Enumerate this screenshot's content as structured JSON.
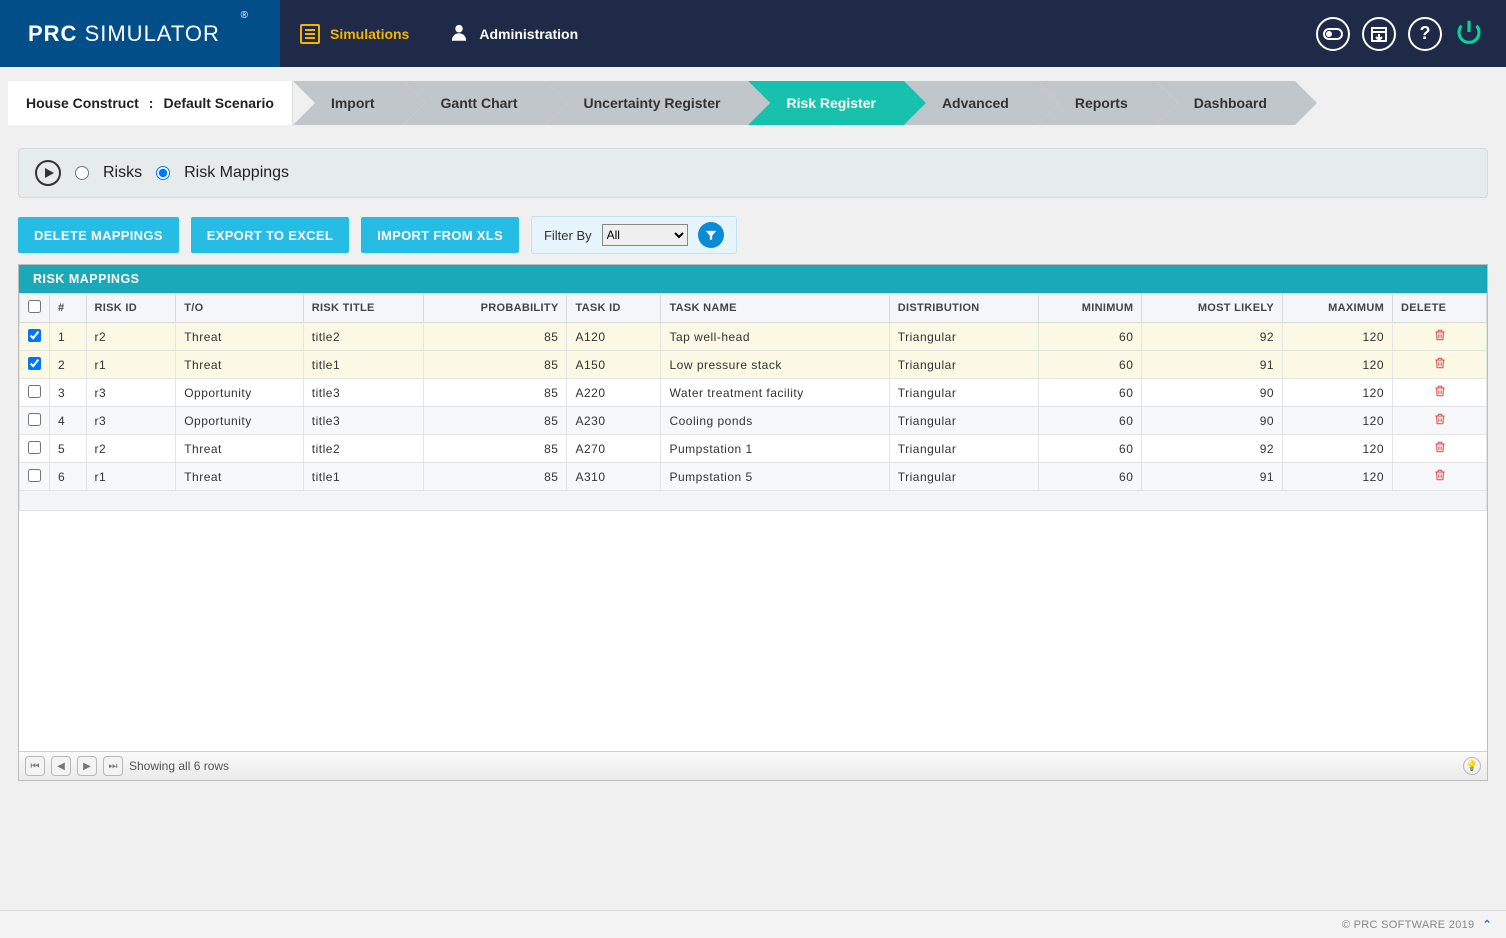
{
  "brand": {
    "bold": "PRC",
    "rest": " SIMULATOR",
    "reg": "®"
  },
  "nav": {
    "sim": "Simulations",
    "admin": "Administration"
  },
  "breadcrumb": {
    "project": "House Construct",
    "sep": ":",
    "scenario": "Default Scenario"
  },
  "tabs": [
    "Import",
    "Gantt Chart",
    "Uncertainty Register",
    "Risk Register",
    "Advanced",
    "Reports",
    "Dashboard"
  ],
  "active_tab": "Risk Register",
  "radio": {
    "risks": "Risks",
    "mappings": "Risk Mappings"
  },
  "buttons": {
    "del": "DELETE MAPPINGS",
    "excel": "EXPORT TO EXCEL",
    "import": "IMPORT FROM XLS"
  },
  "filter": {
    "label": "Filter By",
    "value": "All",
    "options": [
      "All"
    ]
  },
  "panel_title": "RISK MAPPINGS",
  "columns": [
    "#",
    "RISK ID",
    "T/O",
    "RISK TITLE",
    "PROBABILITY",
    "TASK ID",
    "TASK NAME",
    "DISTRIBUTION",
    "MINIMUM",
    "MOST LIKELY",
    "MAXIMUM",
    "DELETE"
  ],
  "rows": [
    {
      "sel": true,
      "n": "1",
      "rid": "r2",
      "to": "Threat",
      "title": "title2",
      "prob": "85",
      "tid": "A120",
      "tname": "Tap well-head",
      "dist": "Triangular",
      "min": "60",
      "ml": "92",
      "max": "120"
    },
    {
      "sel": true,
      "n": "2",
      "rid": "r1",
      "to": "Threat",
      "title": "title1",
      "prob": "85",
      "tid": "A150",
      "tname": "Low pressure stack",
      "dist": "Triangular",
      "min": "60",
      "ml": "91",
      "max": "120"
    },
    {
      "sel": false,
      "n": "3",
      "rid": "r3",
      "to": "Opportunity",
      "title": "title3",
      "prob": "85",
      "tid": "A220",
      "tname": "Water treatment facility",
      "dist": "Triangular",
      "min": "60",
      "ml": "90",
      "max": "120"
    },
    {
      "sel": false,
      "n": "4",
      "rid": "r3",
      "to": "Opportunity",
      "title": "title3",
      "prob": "85",
      "tid": "A230",
      "tname": "Cooling ponds",
      "dist": "Triangular",
      "min": "60",
      "ml": "90",
      "max": "120"
    },
    {
      "sel": false,
      "n": "5",
      "rid": "r2",
      "to": "Threat",
      "title": "title2",
      "prob": "85",
      "tid": "A270",
      "tname": "Pumpstation 1",
      "dist": "Triangular",
      "min": "60",
      "ml": "92",
      "max": "120"
    },
    {
      "sel": false,
      "n": "6",
      "rid": "r1",
      "to": "Threat",
      "title": "title1",
      "prob": "85",
      "tid": "A310",
      "tname": "Pumpstation 5",
      "dist": "Triangular",
      "min": "60",
      "ml": "91",
      "max": "120"
    }
  ],
  "pager": "Showing all 6 rows",
  "footer": "© PRC SOFTWARE 2019"
}
